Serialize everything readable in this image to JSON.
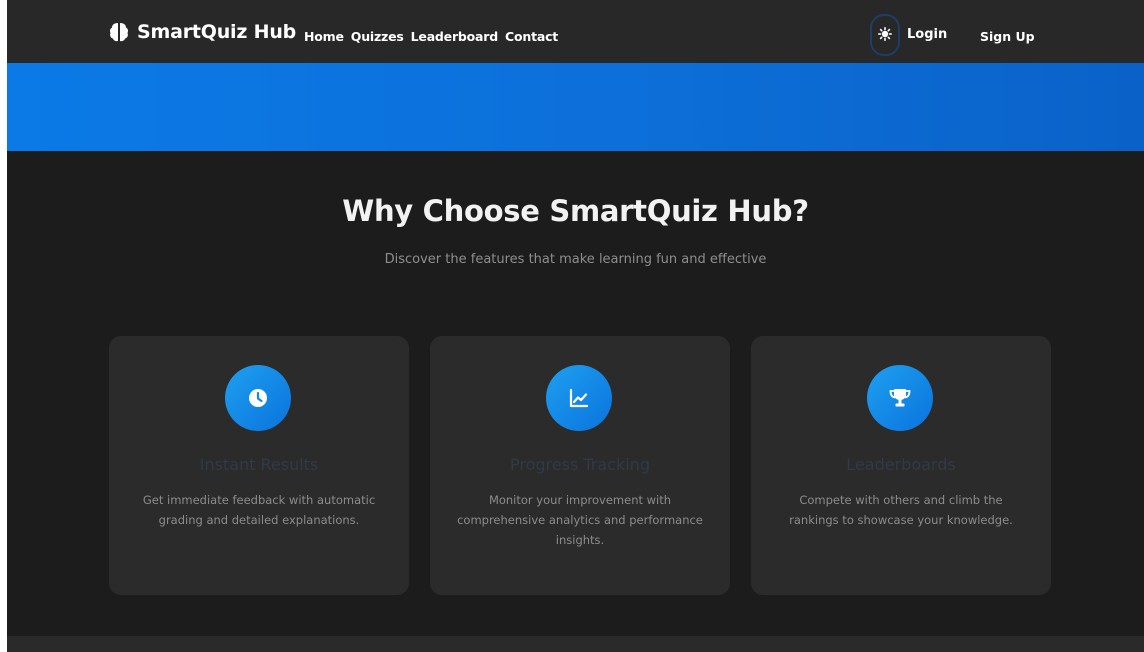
{
  "brand": {
    "name": "SmartQuiz Hub",
    "icon": "brain-icon"
  },
  "nav": {
    "links": [
      "Home",
      "Quizzes",
      "Leaderboard",
      "Contact"
    ],
    "theme_toggle_icon": "sun-icon",
    "login_label": "Login",
    "signup_label": "Sign Up"
  },
  "colors": {
    "accent": "#0b7ae6",
    "navbar_bg": "#282828",
    "page_bg": "#1c1c1c",
    "card_bg": "#2b2b2b"
  },
  "features": {
    "title": "Why Choose SmartQuiz Hub?",
    "subtitle": "Discover the features that make learning fun and effective",
    "cards": [
      {
        "icon": "clock-icon",
        "title": "Instant Results",
        "description": "Get immediate feedback with automatic grading and detailed explanations."
      },
      {
        "icon": "chart-line-icon",
        "title": "Progress Tracking",
        "description": "Monitor your improvement with comprehensive analytics and performance insights."
      },
      {
        "icon": "trophy-icon",
        "title": "Leaderboards",
        "description": "Compete with others and climb the rankings to showcase your knowledge."
      }
    ]
  }
}
